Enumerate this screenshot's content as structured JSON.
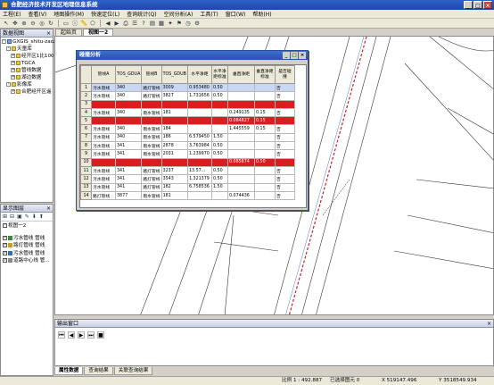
{
  "window": {
    "title": "合肥经济技术开发区地理信息系统"
  },
  "menu": [
    "工程(E)",
    "查看(V)",
    "地图操作(M)",
    "快速定位(L)",
    "查询统计(Q)",
    "空间分析(A)",
    "工具(T)",
    "窗口(W)",
    "帮助(H)"
  ],
  "left_panel": {
    "title": "数据视图",
    "tree": [
      "GXGIS_shitu-zaozuo",
      "天童库",
      "经开区1比1000",
      "TGCA",
      "管线数据",
      "湖边数据",
      "影像库",
      "合肥经开区遥"
    ]
  },
  "map_tabs": [
    "起始页",
    "视图一2"
  ],
  "dialog": {
    "title": "碰撞分析",
    "columns": [
      "",
      "管线A",
      "TOS_GDUA",
      "管线B",
      "TOS_GDUB",
      "水平净距",
      "水平净距标准",
      "垂直净距",
      "垂直净距标准",
      "是否碰撞"
    ],
    "rows": [
      {
        "n": "1",
        "a": "污水管线",
        "ida": "340",
        "b": "路灯管线",
        "idb": "3009",
        "h": "0.953480",
        "hs": "0.50",
        "v": "",
        "vs": "",
        "r": "否",
        "red": false,
        "sel": true
      },
      {
        "n": "2",
        "a": "污水管线",
        "ida": "340",
        "b": "路灯管线",
        "idb": "3827",
        "h": "1.731656",
        "hs": "0.50",
        "v": "",
        "vs": "",
        "r": "否",
        "red": false,
        "sel": false
      },
      {
        "n": "3",
        "a": "污水管线",
        "ida": "340",
        "b": "雨水管线",
        "idb": "160",
        "h": "",
        "hs": "",
        "v": "",
        "vs": "",
        "r": "是",
        "red": true,
        "sel": false
      },
      {
        "n": "4",
        "a": "污水管线",
        "ida": "340",
        "b": "雨水管线",
        "idb": "181",
        "h": "",
        "hs": "",
        "v": "0.249135",
        "vs": "0.15",
        "r": "否",
        "red": false,
        "sel": false
      },
      {
        "n": "5",
        "a": "污水管线",
        "ida": "340",
        "b": "雨水管线",
        "idb": "182",
        "h": "",
        "hs": "",
        "v": "0.084827",
        "vs": "0.15",
        "r": "是",
        "red": true,
        "sel": false
      },
      {
        "n": "6",
        "a": "污水管线",
        "ida": "340",
        "b": "雨水管线",
        "idb": "184",
        "h": "",
        "hs": "",
        "v": "1.445559",
        "vs": "0.15",
        "r": "否",
        "red": false,
        "sel": false
      },
      {
        "n": "7",
        "a": "污水管线",
        "ida": "340",
        "b": "雨水管线",
        "idb": "186",
        "h": "6.579450",
        "hs": "1.50",
        "v": "",
        "vs": "",
        "r": "否",
        "red": false,
        "sel": false
      },
      {
        "n": "8",
        "a": "污水管线",
        "ida": "341",
        "b": "雨水管线",
        "idb": "2878",
        "h": "3.763984",
        "hs": "0.50",
        "v": "",
        "vs": "",
        "r": "否",
        "red": false,
        "sel": false
      },
      {
        "n": "9",
        "a": "污水管线",
        "ida": "341",
        "b": "雨水管线",
        "idb": "2031",
        "h": "1.239970",
        "hs": "0.50",
        "v": "",
        "vs": "",
        "r": "否",
        "red": false,
        "sel": false
      },
      {
        "n": "10",
        "a": "污水管线",
        "ida": "341",
        "b": "雨水管线",
        "idb": "181",
        "h": "",
        "hs": "",
        "v": "0.085874",
        "vs": "0.50",
        "r": "是",
        "red": true,
        "sel": false
      },
      {
        "n": "11",
        "a": "污水管线",
        "ida": "341",
        "b": "路灯管线",
        "idb": "3237",
        "h": "13.57...",
        "hs": "0.50",
        "v": "",
        "vs": "",
        "r": "否",
        "red": false,
        "sel": false
      },
      {
        "n": "12",
        "a": "污水管线",
        "ida": "341",
        "b": "路灯管线",
        "idb": "3543",
        "h": "1.321379",
        "hs": "0.50",
        "v": "",
        "vs": "",
        "r": "否",
        "red": false,
        "sel": false
      },
      {
        "n": "13",
        "a": "污水管线",
        "ida": "341",
        "b": "路灯管线",
        "idb": "182",
        "h": "6.758536",
        "hs": "1.50",
        "v": "",
        "vs": "",
        "r": "否",
        "red": false,
        "sel": false
      },
      {
        "n": "14",
        "a": "路灯管线",
        "ida": "3877",
        "b": "雨水管线",
        "idb": "181",
        "h": "",
        "hs": "",
        "v": "0.074436",
        "vs": "",
        "r": "否",
        "red": false,
        "sel": false
      }
    ]
  },
  "layer_panel": {
    "title": "显示图层",
    "view_label": "视图一2",
    "layers": [
      "污水管线 管线",
      "路灯管线 管线",
      "污水管线 管线",
      "道路中心线 管..."
    ]
  },
  "output_panel": {
    "title": "输出窗口"
  },
  "bottom_tabs": [
    "属性数据",
    "查询结果",
    "关联查询结果"
  ],
  "status": {
    "scale_label": "比例 1 : 492.887",
    "selected_label": "已选择图元 0",
    "x_label": "X 519147.496",
    "y_label": "Y 3518549.934"
  }
}
